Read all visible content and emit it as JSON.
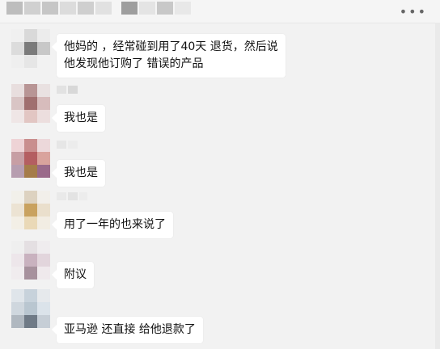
{
  "header": {
    "more_icon": "ellipsis-icon"
  },
  "messages": [
    {
      "text": "他妈的 ，经常碰到用了40天 退货，然后说\n他发现他订购了 错误的产品"
    },
    {
      "text": "我也是"
    },
    {
      "text": "我也是"
    },
    {
      "text": "用了一年的也来说了"
    },
    {
      "text": "附议"
    },
    {
      "text": "亚马逊 还直接 给他退款了"
    }
  ],
  "colors": {
    "background": "#f2f2f2",
    "bubble": "#ffffff",
    "text": "#111111"
  }
}
